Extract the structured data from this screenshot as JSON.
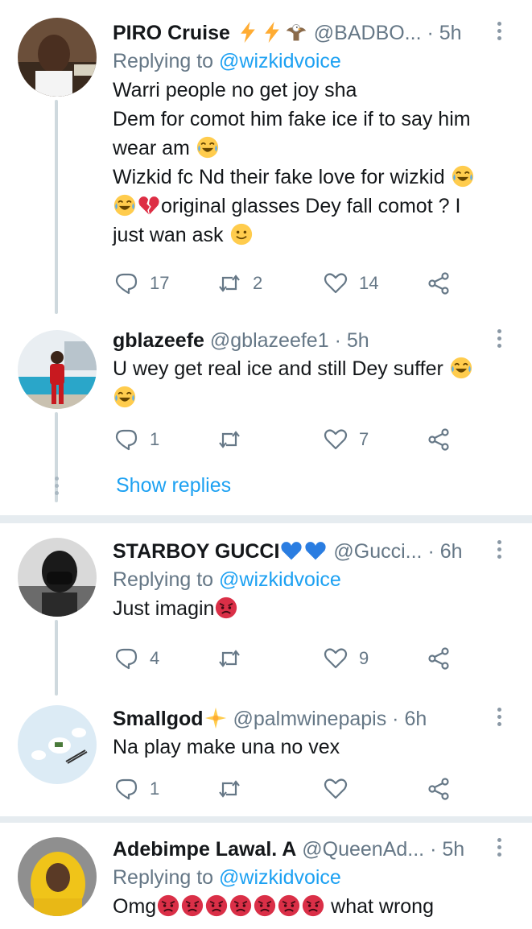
{
  "tweets": [
    {
      "name": "PIRO Cruise",
      "handle": "@BADBO...",
      "dot": "·",
      "time": "5h",
      "replying_prefix": "Replying to",
      "replying_to": "@wizkidvoice",
      "lines": [
        "Warri people no get joy sha",
        "Dem for comot him fake ice if to say him",
        "wear am",
        "Wizkid fc Nd their fake love for wizkid",
        "original glasses Dey fall comot ? I",
        "just wan ask"
      ],
      "reply_count": "17",
      "retweet_count": "2",
      "like_count": "14"
    },
    {
      "name": "gblazeefe",
      "handle": "@gblazeefe1",
      "dot": "·",
      "time": "5h",
      "lines": [
        "U wey get real ice and still Dey suffer"
      ],
      "reply_count": "1",
      "retweet_count": "",
      "like_count": "7"
    },
    {
      "name": "STARBOY GUCCI",
      "handle": "@Gucci...",
      "dot": "·",
      "time": "6h",
      "replying_prefix": "Replying to",
      "replying_to": "@wizkidvoice",
      "lines": [
        "Just imagin"
      ],
      "reply_count": "4",
      "retweet_count": "",
      "like_count": "9"
    },
    {
      "name": "Smallgod",
      "handle": "@palmwinepapis",
      "dot": "·",
      "time": "6h",
      "lines": [
        "Na play make una no vex"
      ],
      "reply_count": "1",
      "retweet_count": "",
      "like_count": ""
    },
    {
      "name": "Adebimpe Lawal. A",
      "handle": "@QueenAd...",
      "dot": "·",
      "time": "5h",
      "replying_prefix": "Replying to",
      "replying_to": "@wizkidvoice",
      "lines": [
        "Omg",
        "what wrong"
      ]
    }
  ],
  "show_replies": "Show replies",
  "icons": {
    "reply": "reply-icon",
    "retweet": "retweet-icon",
    "like": "like-icon",
    "share": "share-icon",
    "more": "more-icon",
    "laugh": "face-with-tears-of-joy-icon",
    "broken_heart": "broken-heart-icon",
    "smile": "slightly-smiling-face-icon",
    "angry": "angry-face-icon",
    "blue_heart": "blue-heart-icon",
    "lightning": "lightning-icon",
    "eagle": "eagle-icon",
    "sparkle": "sparkle-star-icon"
  },
  "colors": {
    "link": "#1da1f2",
    "secondary_text": "#657786",
    "divider": "#e6ecf0",
    "thread_line": "#cfd9de"
  }
}
